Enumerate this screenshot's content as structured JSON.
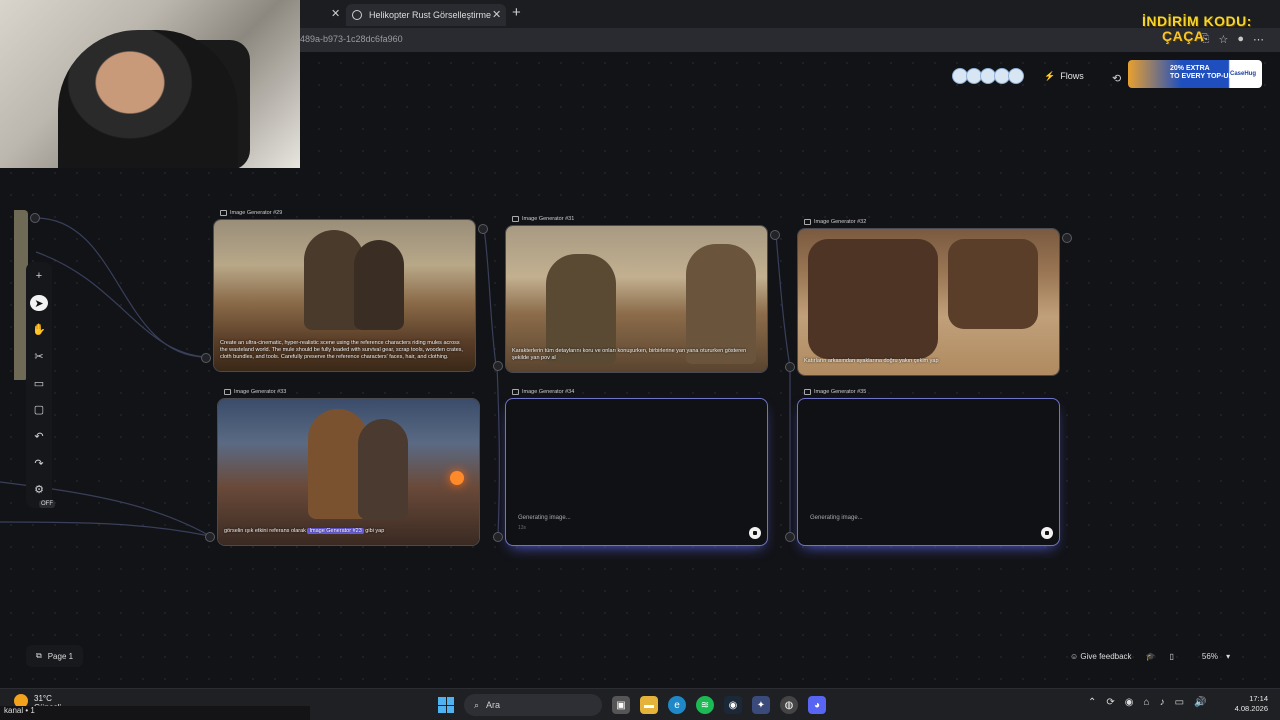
{
  "browser": {
    "tab_title": "Helikopter Rust Görselleştirme",
    "url_fragment": "489a-b973-1c28dc6fa960",
    "new_tab_symbol": "+",
    "close_symbol": "✕"
  },
  "overlay": {
    "promo_line1": "İNDİRİM KODU:",
    "promo_line2": "ÇAÇA"
  },
  "header": {
    "flows_label": "Flows",
    "ad_line1": "20% EXTRA",
    "ad_line2": "TO EVERY TOP-UP",
    "ad_brand": "CaseHug"
  },
  "nodes": [
    {
      "label": "Image Generator #29",
      "caption": "Create an ultra-cinematic, hyper-realistic scene using the reference characters riding mules across the wasteland world. The mule should be fully loaded with survival gear, scrap tools, wooden crates, cloth bundles, and tools. Carefully preserve the reference characters' faces, hair, and clothing."
    },
    {
      "label": "Image Generator #31",
      "caption": "Karakterlerin tüm detaylarını koru ve onları konuşurken, birbirlerine yan yana otururken gösteren şekilde yan pov al"
    },
    {
      "label": "Image Generator #32",
      "caption": "Katırların arkasından ayaklarına doğru yakın çekim yap"
    },
    {
      "label": "Image Generator #33",
      "caption_pre": "görselin ışık etkini referans olarak",
      "caption_chip": "Image Generator #23",
      "caption_post": "gibi yap"
    },
    {
      "label": "Image Generator #34",
      "status": "Generating image...",
      "time": "13s"
    },
    {
      "label": "Image Generator #35",
      "status": "Generating image..."
    }
  ],
  "toolbar": {
    "off_badge": "OFF"
  },
  "footer": {
    "page_label": "Page 1",
    "feedback_label": "Give feedback",
    "zoom": "56%"
  },
  "taskbar": {
    "temperature": "31°C",
    "weather_text": "Güneşli",
    "streamer_tag": "kanal • 1",
    "search_placeholder": "Ara",
    "time": "17:14",
    "date": "4.08.2026"
  },
  "colors": {
    "accent": "#6b5ee0",
    "generating_glow": "#5b63e6",
    "promo": "#f5d62c"
  }
}
